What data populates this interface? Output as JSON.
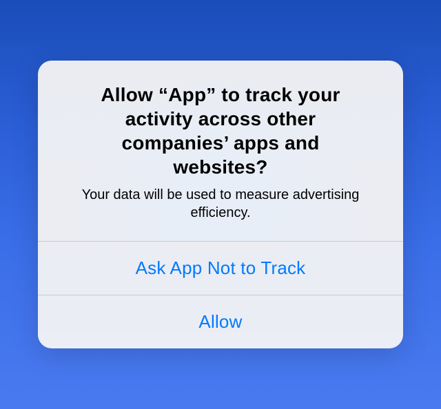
{
  "dialog": {
    "title": "Allow “App” to track your activity across other companies’ apps and websites?",
    "message": "Your data will be used to measure advertising efficiency.",
    "buttons": {
      "deny": "Ask App Not to Track",
      "allow": "Allow"
    }
  },
  "colors": {
    "accent": "#007aff"
  }
}
